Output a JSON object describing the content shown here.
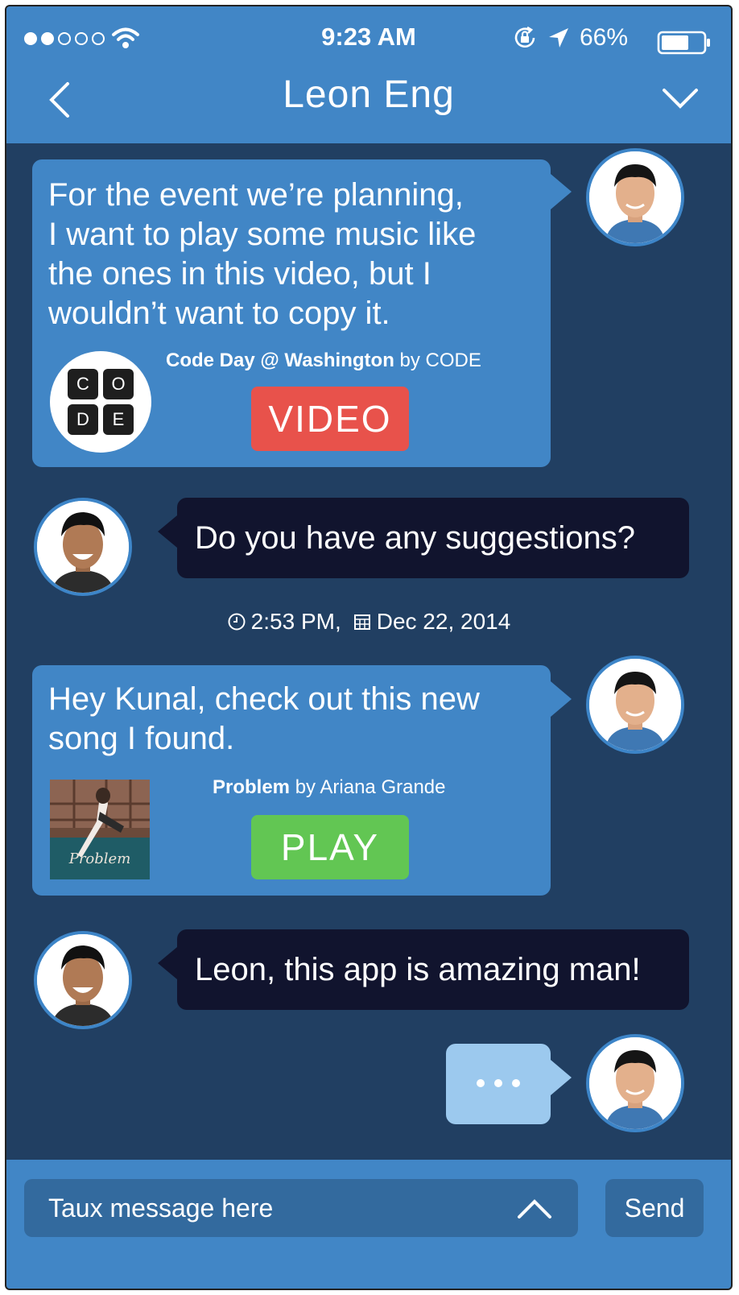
{
  "status_bar": {
    "time": "9:23 AM",
    "battery_percent": "66%",
    "signal_bars_filled": 2,
    "signal_bars_total": 5,
    "battery_level": 0.66
  },
  "header": {
    "title": "Leon Eng",
    "back_icon": "chevron-left-icon",
    "menu_icon": "chevron-down-icon"
  },
  "messages": [
    {
      "text_lines": [
        "For the event we’re planning,",
        "I want to play some music like",
        "the ones in this video, but I",
        "wouldn’t want to copy it."
      ],
      "media": {
        "title": "Code Day @ Washington",
        "by": "by CODE",
        "button": "VIDEO",
        "logo_letters": [
          "C",
          "O",
          "D",
          "E"
        ]
      }
    },
    {
      "text": "Do you have any suggestions?"
    },
    {
      "text_lines": [
        "Hey Kunal, check out this new",
        "song I found."
      ],
      "media": {
        "title": "Problem",
        "by": "by Ariana Grande",
        "button": "PLAY"
      }
    },
    {
      "text": "Leon, this app is amazing man!"
    }
  ],
  "timestamp": {
    "time": "2:53 PM,",
    "date": "Dec 22, 2014"
  },
  "composer": {
    "placeholder": "Taux message here",
    "send_label": "Send"
  },
  "colors": {
    "header": "#4186c6",
    "background": "#213f62",
    "outgoing_bubble": "#4186c6",
    "incoming_bubble": "#11142e",
    "video_button": "#e8524b",
    "play_button": "#62c653",
    "typing_bubble": "#9cc9ee"
  }
}
